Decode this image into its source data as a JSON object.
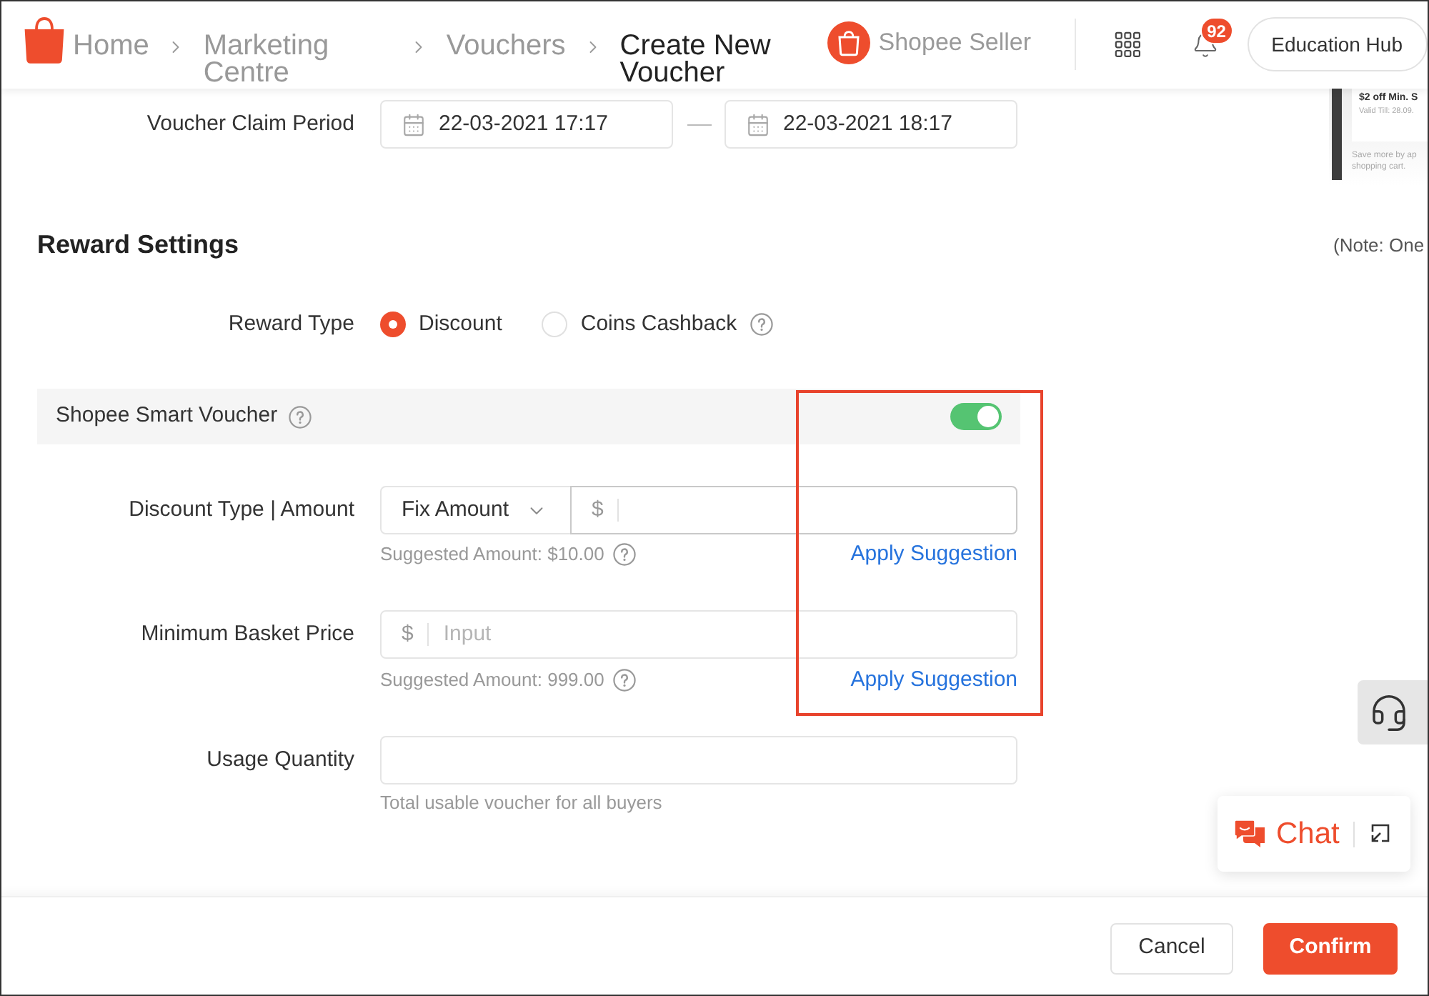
{
  "header": {
    "breadcrumb": [
      {
        "label": "Home",
        "current": false
      },
      {
        "label": "Marketing Centre",
        "current": false
      },
      {
        "label": "Vouchers",
        "current": false
      },
      {
        "label": "Create New Voucher",
        "current": true
      }
    ],
    "brand": "Shopee Seller",
    "notifications": "92",
    "education_hub": "Education Hub"
  },
  "preview": {
    "title": "$2 off Min. S",
    "validity": "Valid Till: 28.09.",
    "description": "Save more by ap shopping cart."
  },
  "claim_period": {
    "label": "Voucher Claim Period",
    "start": "22-03-2021 17:17",
    "end": "22-03-2021 18:17"
  },
  "reward_settings": {
    "title": "Reward Settings",
    "note": "(Note: One",
    "reward_type": {
      "label": "Reward Type",
      "options": [
        {
          "label": "Discount",
          "selected": true
        },
        {
          "label": "Coins Cashback",
          "selected": false
        }
      ]
    },
    "smart_voucher": {
      "label": "Shopee Smart Voucher",
      "on": true
    },
    "discount": {
      "label": "Discount Type | Amount",
      "type": "Fix Amount",
      "currency": "$",
      "suggestion": "Suggested Amount: $10.00",
      "apply": "Apply Suggestion"
    },
    "min_basket": {
      "label": "Minimum Basket Price",
      "currency": "$",
      "placeholder": "Input",
      "suggestion": "Suggested Amount: 999.00",
      "apply": "Apply Suggestion"
    },
    "usage_quantity": {
      "label": "Usage Quantity",
      "hint": "Total usable voucher for all buyers"
    }
  },
  "chat": {
    "label": "Chat"
  },
  "footer": {
    "buttons": [
      {
        "label": "Cancel",
        "kind": "secondary"
      },
      {
        "label": "Confirm",
        "kind": "primary"
      }
    ]
  }
}
